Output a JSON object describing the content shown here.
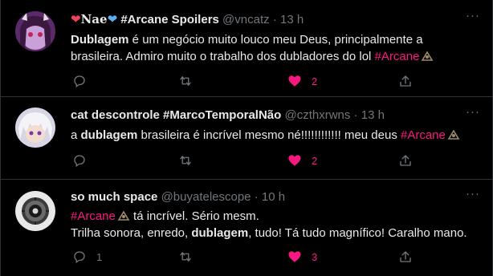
{
  "tweets": [
    {
      "display_name_prefix": "",
      "display_name": "𝐍𝐚𝐞",
      "display_name_suffix": "#Arcane Spoilers",
      "handle": "@vncatz",
      "separator": "·",
      "time": "13 h",
      "text_parts": [
        {
          "bold": "Dublagem"
        },
        {
          "plain": " é um negócio muito louco meu Deus, principalmente a brasileira. Admiro muito o trabalho dos dubladores do lol "
        },
        {
          "hashtag": "#Arcane"
        }
      ],
      "reply_count": "",
      "retweet_count": "",
      "like_count": "2",
      "liked": true,
      "avatar_icon": "anime-girl-avatar"
    },
    {
      "display_name": "cat descontrole #MarcoTemporalNão",
      "handle": "@czthxrwns",
      "separator": "·",
      "time": "13 h",
      "text_parts": [
        {
          "plain": "a "
        },
        {
          "bold": "dublagem"
        },
        {
          "plain": " brasileira é incrível mesmo né!!!!!!!!!!!! meu deus "
        },
        {
          "hashtag": "#Arcane"
        }
      ],
      "reply_count": "",
      "retweet_count": "",
      "like_count": "2",
      "liked": true,
      "avatar_icon": "white-haired-anime-avatar"
    },
    {
      "display_name": "so much space",
      "handle": "@buyatelescope",
      "separator": "·",
      "time": "10 h",
      "text_line1_parts": [
        {
          "hashtag": "#Arcane"
        },
        {
          "plain": " tá incrível. Sério mesm."
        }
      ],
      "text_line2_parts": [
        {
          "plain": "Trilha sonora, enredo, "
        },
        {
          "bold": "dublagem"
        },
        {
          "plain": ", tudo! Tá tudo magnífico! Caralho mano."
        }
      ],
      "reply_count": "1",
      "retweet_count": "",
      "like_count": "3",
      "liked": true,
      "avatar_icon": "portal-core-avatar"
    }
  ],
  "icons": {
    "reply": "reply-icon",
    "retweet": "retweet-icon",
    "like": "heart-filled-icon",
    "share": "share-icon",
    "more": "more-icon"
  },
  "colors": {
    "background": "#000000",
    "text": "#e7e9ea",
    "secondary": "#71767b",
    "accent_pink": "#f91880",
    "divider": "#2f3336"
  }
}
